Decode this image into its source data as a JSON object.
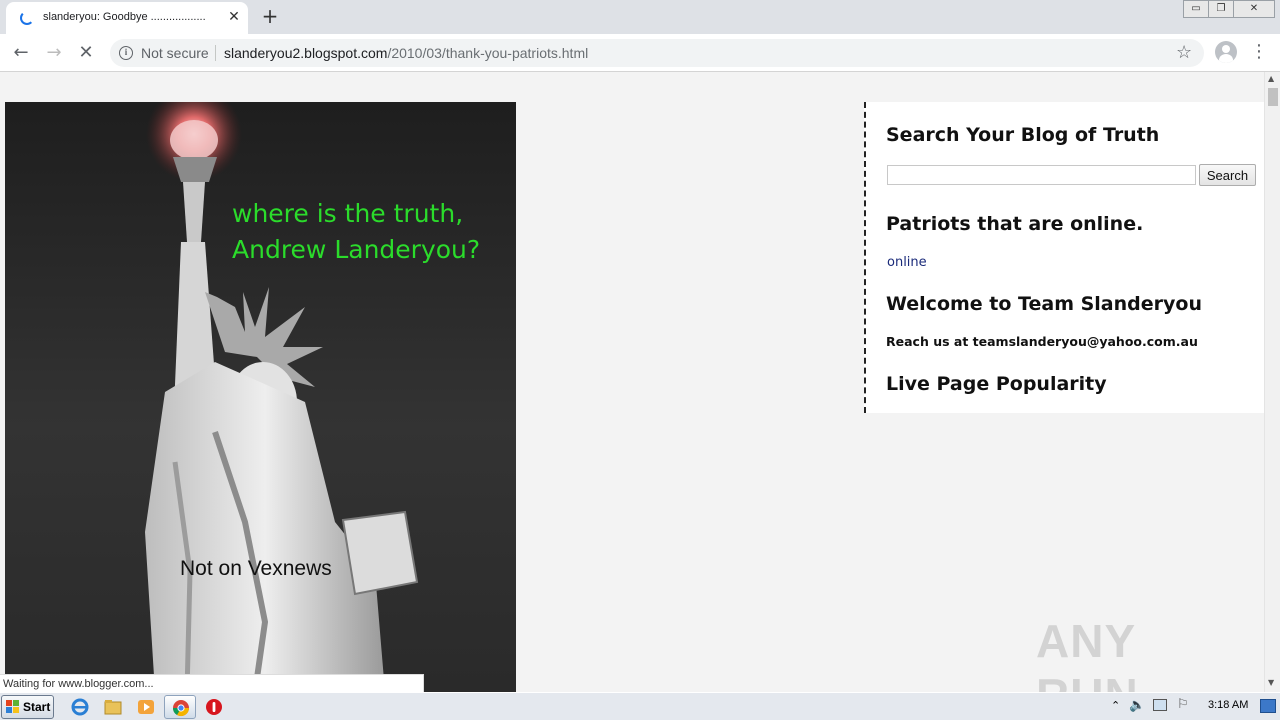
{
  "browser": {
    "tab_title": "slanderyou: Goodbye ..................",
    "tab_close": "✕",
    "new_tab": "+",
    "window_controls": {
      "minimize": "▭",
      "restore": "❐",
      "close": "✕"
    },
    "nav": {
      "back": "←",
      "forward": "→",
      "stop": "✕"
    },
    "security_label": "Not secure",
    "url_host": "slanderyou2.blogspot.com",
    "url_path": "/2010/03/thank-you-patriots.html",
    "star": "☆",
    "menu": "⋮"
  },
  "poster": {
    "caption_line1": "where is the truth,",
    "caption_line2": "Andrew Landeryou?",
    "footer": "Not on Vexnews"
  },
  "sidebar": {
    "search_heading": "Search Your Blog of Truth",
    "search_input_value": "",
    "search_button": "Search",
    "patriots_heading": "Patriots that are online.",
    "online_link": "online",
    "welcome_heading": "Welcome to Team Slanderyou",
    "contact": "Reach us at teamslanderyou@yahoo.com.au",
    "popularity_heading": "Live Page Popularity"
  },
  "status_bar": "Waiting for www.blogger.com...",
  "watermark": "ANY RUN",
  "taskbar": {
    "start": "Start",
    "clock": "3:18 AM"
  },
  "colors": {
    "caption_green": "#2bdc2b",
    "link_blue": "#1b2b7a",
    "spinner_blue": "#1a73e8"
  }
}
